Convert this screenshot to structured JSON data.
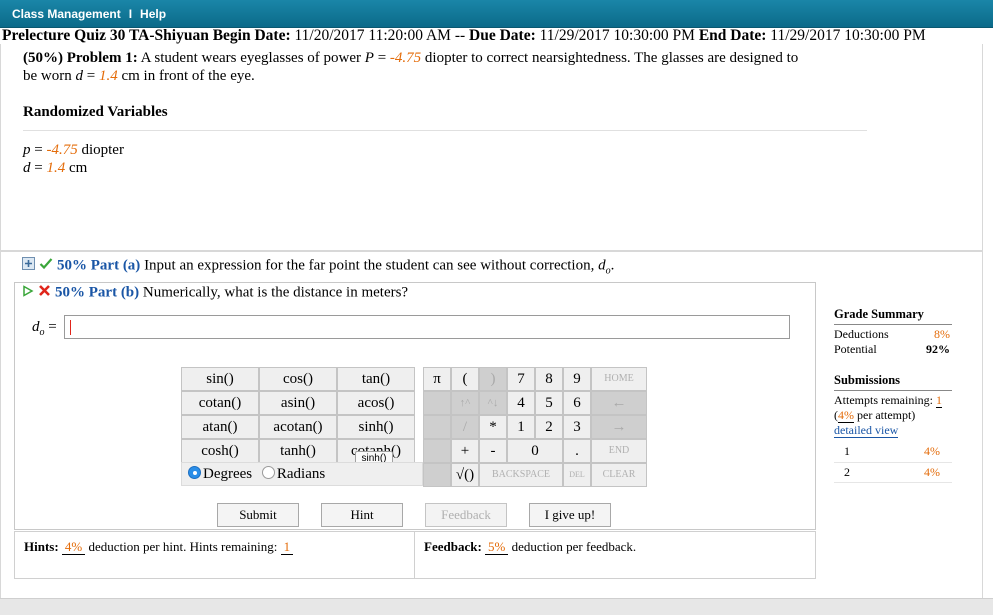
{
  "menu": {
    "class_management": "Class Management",
    "separator": "I",
    "help": "Help"
  },
  "quiz": {
    "name": "Prelecture Quiz 30 TA-Shiyuan",
    "begin_label": "Begin Date:",
    "begin_value": "11/20/2017 11:20:00 AM",
    "dash": "--",
    "due_label": "Due Date:",
    "due_value": "11/29/2017 10:30:00 PM",
    "end_label": "End Date:",
    "end_value": "11/29/2017 10:30:00 PM"
  },
  "problem": {
    "weight": "(50%)",
    "title": "Problem 1:",
    "t1": "A student wears eyeglasses of power",
    "P": "P",
    "eq": " = ",
    "p_value": "-4.75",
    "t2": "diopter to correct nearsightedness. The glasses are designed to",
    "t3": "be worn",
    "d": "d",
    "d_value": "1.4",
    "t4": "cm in front of the eye."
  },
  "randomized": {
    "title": "Randomized Variables",
    "p_name": "p",
    "p_value": "-4.75",
    "p_unit": "diopter",
    "d_name": "d",
    "d_value": "1.4",
    "d_unit": "cm"
  },
  "parts": {
    "a_label": "50% Part (a)",
    "a_text": "Input an expression for the far point the student can see without correction,",
    "a_var": "d",
    "a_sub": "o",
    "b_label": "50% Part (b)",
    "b_text": "Numerically, what is the distance in meters?"
  },
  "answer": {
    "var": "d",
    "sub": "o",
    "eq": "="
  },
  "calculator": {
    "functions": [
      "sin()",
      "cos()",
      "tan()",
      "cotan()",
      "asin()",
      "acos()",
      "atan()",
      "acotan()",
      "sinh()",
      "cosh()",
      "tanh()",
      "cotanh()"
    ],
    "tooltip": "sinh()",
    "degrees": "Degrees",
    "radians": "Radians",
    "pi": "π",
    "lparen": "(",
    "rparen": ")",
    "up": "↑^",
    "down": "^↓",
    "slash": "/",
    "star": "*",
    "plus": "+",
    "minus": "-",
    "sqrt": "√()",
    "digits": [
      "7",
      "8",
      "9",
      "4",
      "5",
      "6",
      "1",
      "2",
      "3",
      "0",
      "."
    ],
    "home": "HOME",
    "left": "←",
    "right": "→",
    "end": "END",
    "backspace": "BACKSPACE",
    "del": "DEL",
    "clear": "CLEAR"
  },
  "buttons": {
    "submit": "Submit",
    "hint": "Hint",
    "feedback": "Feedback",
    "give_up": "I give up!"
  },
  "hints": {
    "label": "Hints:",
    "pct": "4%",
    "text": "deduction per hint. Hints remaining:",
    "remaining": "1"
  },
  "feedback": {
    "label": "Feedback:",
    "pct": "5%",
    "text": "deduction per feedback."
  },
  "grade": {
    "title": "Grade Summary",
    "deductions_label": "Deductions",
    "deductions_value": "8%",
    "potential_label": "Potential",
    "potential_value": "92%",
    "submissions_title": "Submissions",
    "attempts_label": "Attempts remaining:",
    "attempts_value": "1",
    "per_attempt_pct": "4%",
    "per_attempt_text": "per attempt)",
    "open_paren": "(",
    "detailed": "detailed view",
    "rows": [
      {
        "n": "1",
        "v": "4%"
      },
      {
        "n": "2",
        "v": "4%"
      }
    ]
  },
  "colors": {
    "accent": "#0b6a89",
    "value": "#e46c0a",
    "link": "#1a56a6",
    "wrong": "#e0251b",
    "correct": "#3aa63a"
  }
}
